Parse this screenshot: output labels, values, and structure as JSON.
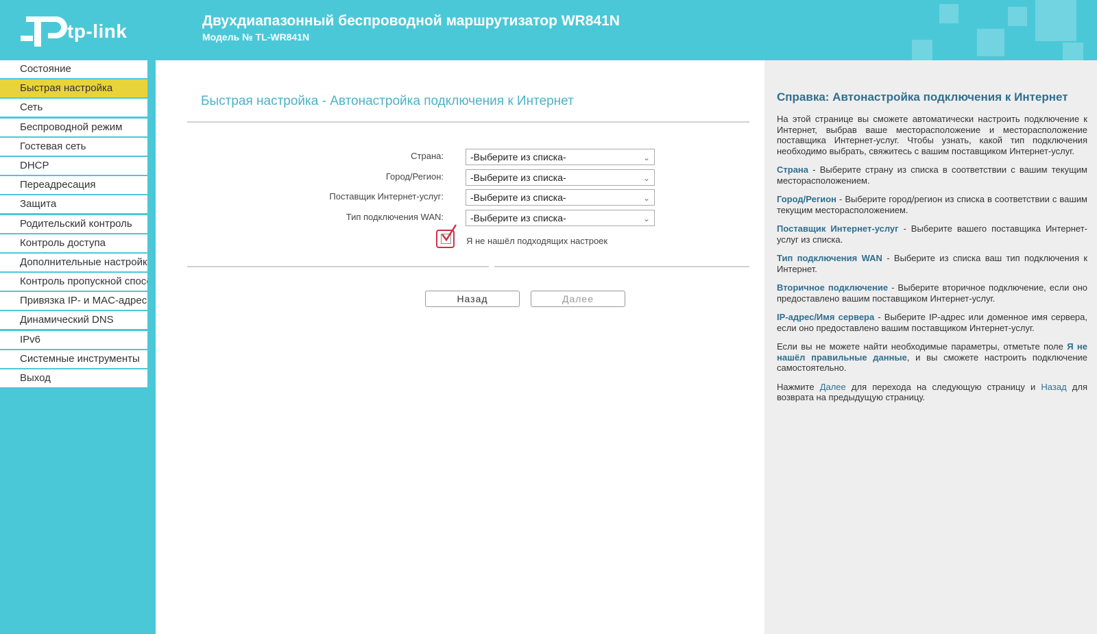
{
  "header": {
    "brand": "tp-link",
    "title": "Двухдиапазонный беспроводной маршрутизатор WR841N",
    "model": "Модель № TL-WR841N"
  },
  "sidebar": {
    "items": [
      {
        "label": "Состояние"
      },
      {
        "label": "Быстрая настройка",
        "active": true
      },
      {
        "label": "Сеть"
      },
      {
        "label": "Беспроводной режим"
      },
      {
        "label": "Гостевая сеть"
      },
      {
        "label": "DHCP"
      },
      {
        "label": "Переадресация"
      },
      {
        "label": "Защита"
      },
      {
        "label": "Родительский контроль"
      },
      {
        "label": "Контроль доступа"
      },
      {
        "label": "Дополнительные настройки маршрутизации"
      },
      {
        "label": "Контроль пропускной способности"
      },
      {
        "label": "Привязка IP- и MAC-адресов"
      },
      {
        "label": "Динамический DNS"
      },
      {
        "label": "IPv6"
      },
      {
        "label": "Системные инструменты"
      },
      {
        "label": "Выход"
      }
    ]
  },
  "main": {
    "title": "Быстрая настройка - Автонастройка подключения к Интернет",
    "fields": [
      {
        "label": "Страна:",
        "value": "-Выберите из списка-"
      },
      {
        "label": "Город/Регион:",
        "value": "-Выберите из списка-"
      },
      {
        "label": "Поставщик Интернет-услуг:",
        "value": "-Выберите из списка-"
      },
      {
        "label": "Тип подключения WAN:",
        "value": "-Выберите из списка-"
      }
    ],
    "checkbox_label": "Я не нашёл подходящих настроек",
    "back_label": "Назад",
    "next_label": "Далее"
  },
  "help": {
    "title": "Справка: Автонастройка подключения к Интернет",
    "intro": "На этой странице вы сможете автоматически настроить подключение к Интернет, выбрав ваше месторасположение и месторасположение поставщика Интернет-услуг. Чтобы узнать, какой тип подключения необходимо выбрать, свяжитесь с вашим поставщиком Интернет-услуг.",
    "items": [
      {
        "term": "Страна",
        "text": " - Выберите страну из списка в соответствии с вашим текущим месторасположением."
      },
      {
        "term": "Город/Регион",
        "text": " - Выберите город/регион из списка в соответствии с вашим текущим месторасположением."
      },
      {
        "term": "Поставщик Интернет-услуг",
        "text": " - Выберите вашего поставщика Интернет-услуг из списка."
      },
      {
        "term": "Тип подключения WAN",
        "text": " - Выберите из списка ваш тип подключения к Интернет."
      },
      {
        "term": "Вторичное подключение",
        "text": " - Выберите вторичное подключение, если оно предоставлено вашим поставщиком Интернет-услуг."
      },
      {
        "term": "IP-адрес/Имя сервера",
        "text": " - Выберите IP-адрес или доменное имя сервера, если оно предоставлено вашим поставщиком Интернет-услуг."
      }
    ],
    "note_pre": "Если вы не можете найти необходимые параметры, отметьте поле ",
    "note_term": "Я не нашёл правильные данные",
    "note_post": ", и вы сможете настроить подключение самостоятельно.",
    "final_pre": "Нажмите ",
    "final_next": "Далее",
    "final_mid": " для перехода на следующую страницу и ",
    "final_back": "Назад",
    "final_post": " для возврата на предыдущую страницу."
  }
}
